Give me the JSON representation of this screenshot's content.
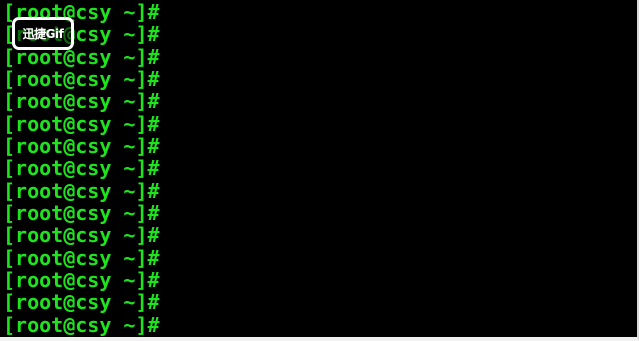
{
  "terminal": {
    "prompt_lines": [
      "[root@csy ~]#",
      "[root@csy ~]#",
      "[root@csy ~]#",
      "[root@csy ~]#",
      "[root@csy ~]#",
      "[root@csy ~]#",
      "[root@csy ~]#",
      "[root@csy ~]#",
      "[root@csy ~]#",
      "[root@csy ~]#",
      "[root@csy ~]#",
      "[root@csy ~]#",
      "[root@csy ~]#",
      "[root@csy ~]#",
      "[root@csy ~]#"
    ],
    "text_color": "#1ee41e",
    "background_color": "#000000"
  },
  "watermark": {
    "label": "迅捷Gif"
  }
}
